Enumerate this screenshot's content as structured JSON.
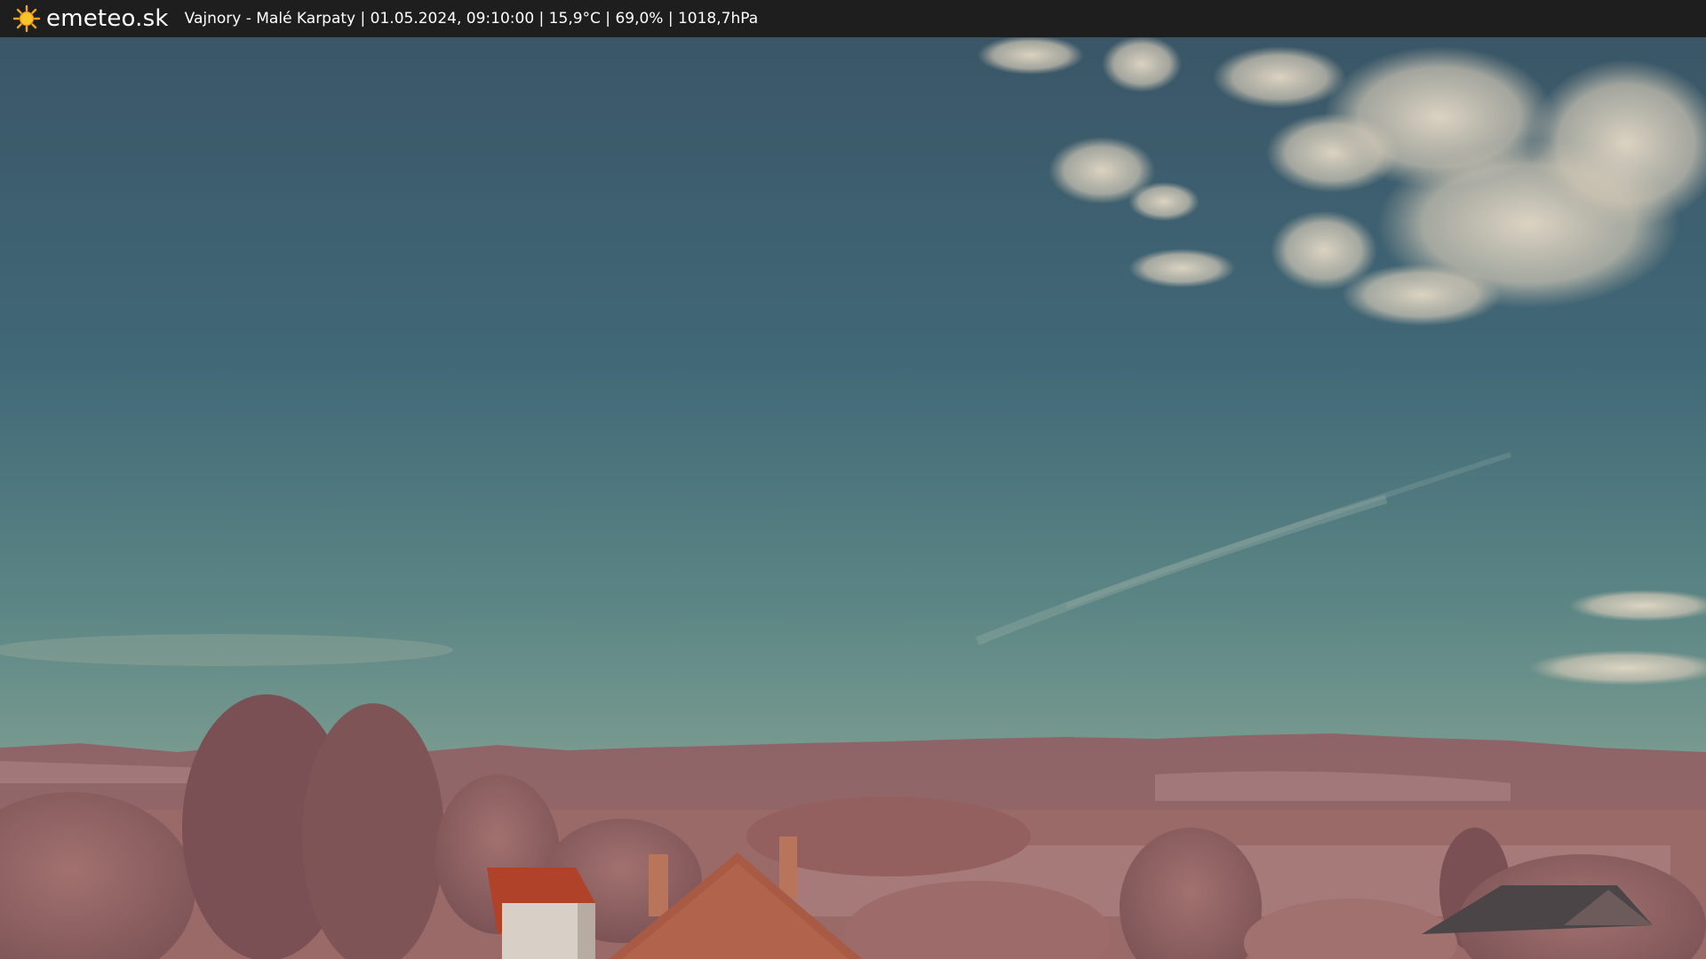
{
  "header": {
    "logo_icon": "sun-icon",
    "brand": "emeteo.sk",
    "caption": "Vajnory - Malé Karpaty | 01.05.2024, 09:10:00 | 15,9°C | 69,0% | 1018,7hPa"
  },
  "colors": {
    "bar_background": "#1e1e1e",
    "sky_top": "#3d5c6c",
    "sky_horizon": "#7e9e92",
    "foliage": "#a86f6c",
    "roof": "#b0422a"
  }
}
